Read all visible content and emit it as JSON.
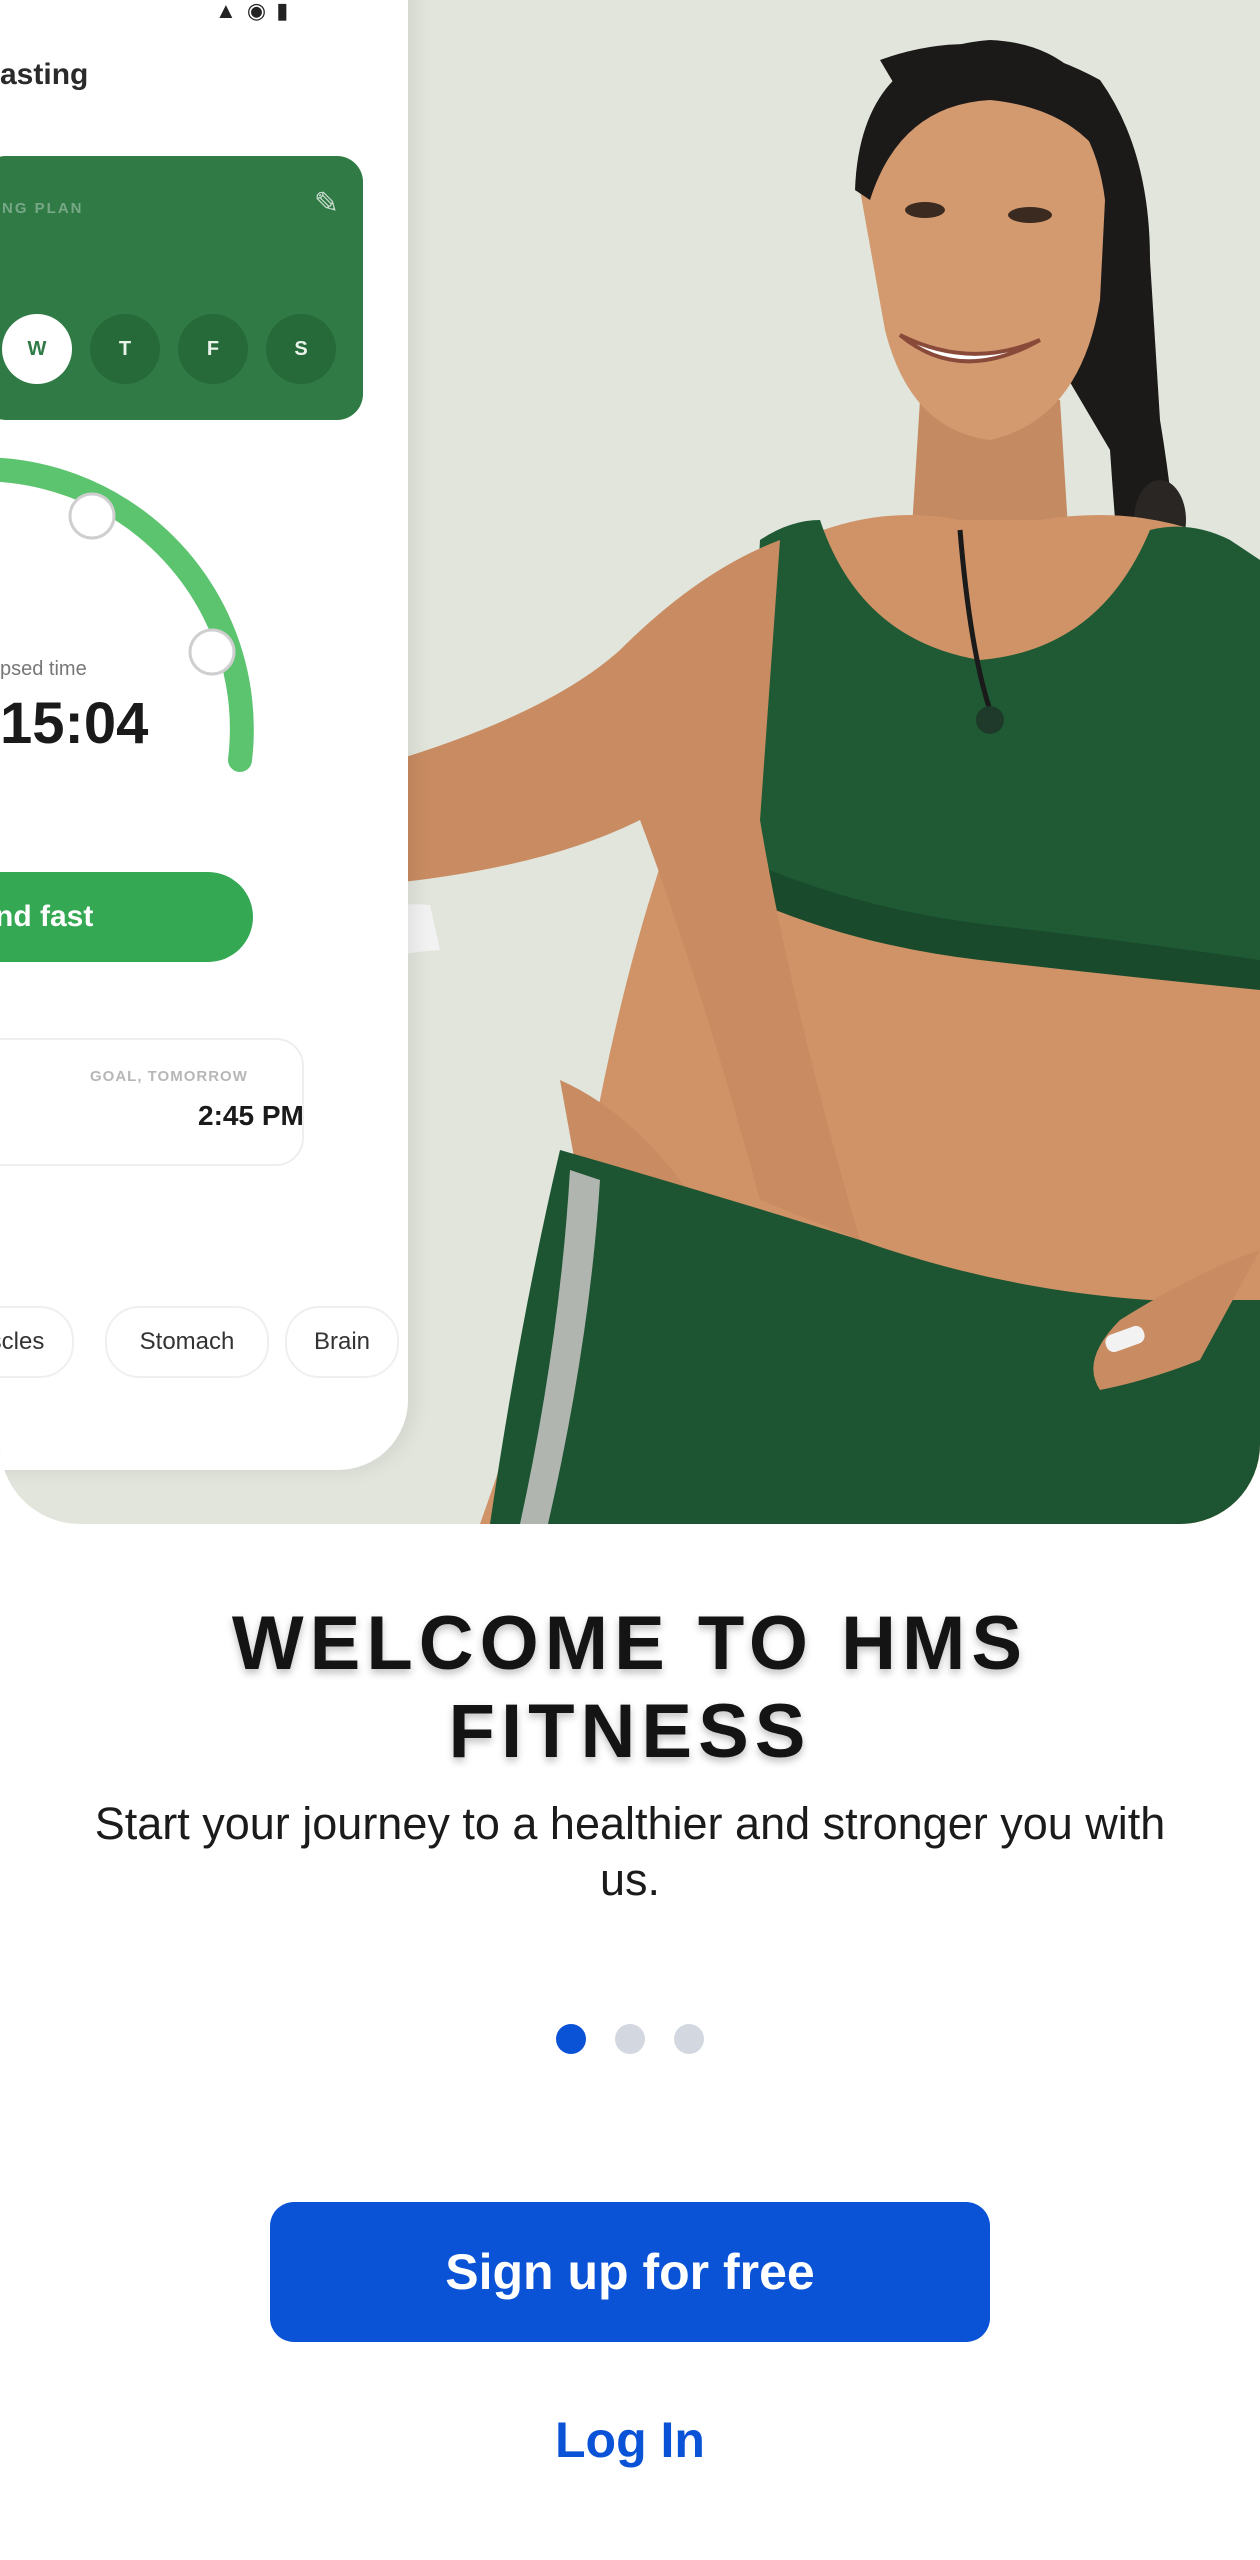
{
  "hero": {
    "app_header": "asting",
    "plan_label": "NG PLAN",
    "days": [
      "W",
      "T",
      "F",
      "S"
    ],
    "active_day": "W",
    "elapsed_label": "psed time",
    "elapsed_time": "15:04",
    "end_fast_label": "nd fast",
    "goal_label": "GOAL, TOMORROW",
    "goal_time": "2:45 PM",
    "chips": [
      "scles",
      "Stomach",
      "Brain"
    ]
  },
  "welcome": {
    "title": "WELCOME TO HMS FITNESS",
    "subtitle": "Start your journey to a healthier and stronger you with us."
  },
  "pager": {
    "count": 3,
    "active_index": 0
  },
  "actions": {
    "signup_label": "Sign up for free",
    "login_label": "Log In"
  },
  "colors": {
    "primary": "#0a52d6",
    "app_green": "#2f7a45",
    "accent_green": "#34a853",
    "outfit_green": "#1f5a35",
    "hero_bg": "#e1e5dc"
  }
}
